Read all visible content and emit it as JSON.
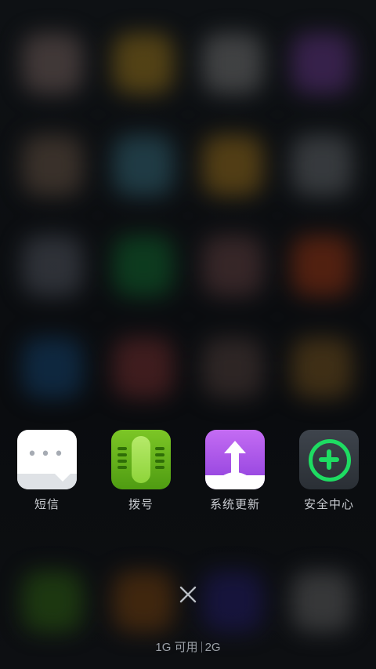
{
  "recent_apps": [
    {
      "label": "短信",
      "icon": "messages-icon"
    },
    {
      "label": "拨号",
      "icon": "dialer-icon"
    },
    {
      "label": "系统更新",
      "icon": "system-update-icon"
    },
    {
      "label": "安全中心",
      "icon": "security-center-icon"
    }
  ],
  "memory": {
    "available": "1G 可用",
    "total": "2G"
  },
  "close": {
    "icon": "close-icon"
  },
  "colors": {
    "security_green": "#1edc62",
    "update_purple": "#a752e8",
    "dialer_green": "#62b31a",
    "label_text": "#c8cbd0"
  }
}
